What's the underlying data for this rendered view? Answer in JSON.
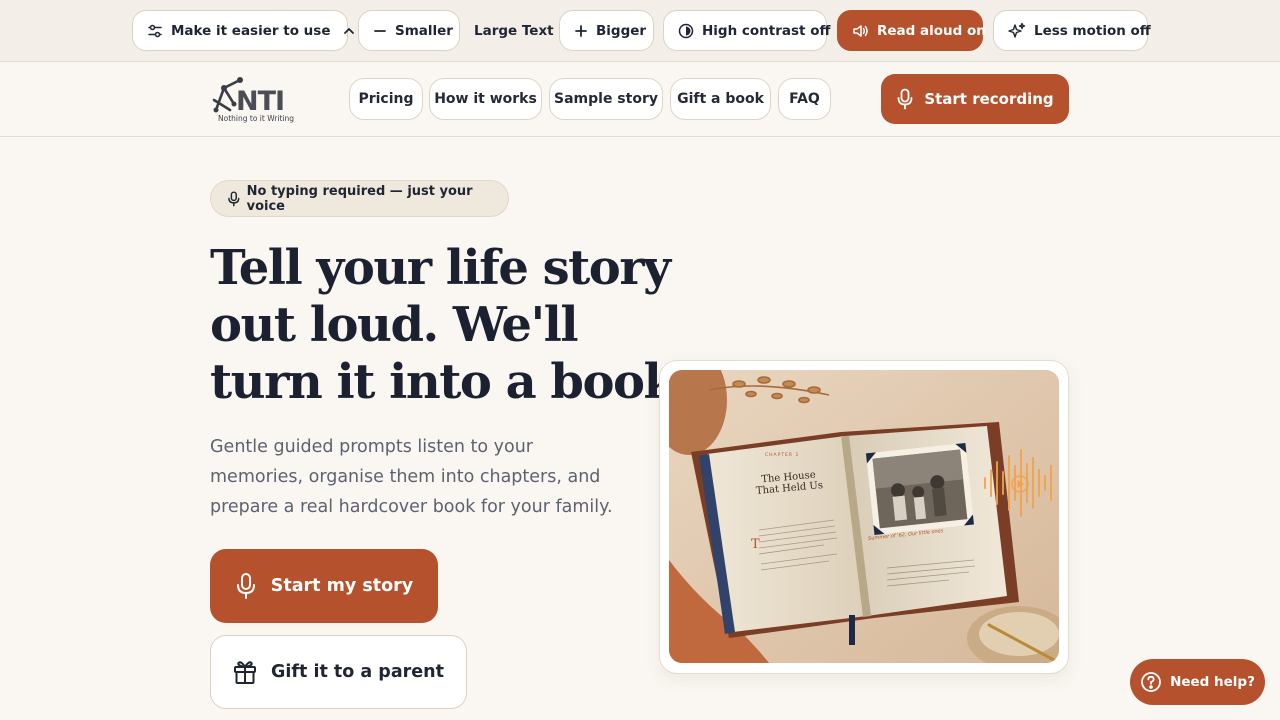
{
  "accessibility_bar": {
    "easier": "Make it easier to use",
    "smaller": "Smaller",
    "text_size": "Large Text",
    "bigger": "Bigger",
    "contrast": "High contrast off",
    "read_aloud": "Read aloud on",
    "motion": "Less motion off"
  },
  "brand": {
    "logo_text": "NTI",
    "tagline": "Nothing to it Writing"
  },
  "nav": {
    "links": [
      "Pricing",
      "How it works",
      "Sample story",
      "Gift a book",
      "FAQ"
    ],
    "record_label": "Start recording"
  },
  "hero": {
    "badge": "No typing required — just your voice",
    "title_lines": [
      "Tell your life story",
      "out loud. We'll",
      "turn it into a book."
    ],
    "subtitle": "Gentle guided prompts listen to your memories, organise them into chapters, and prepare a real hardcover book for your family.",
    "primary_cta": "Start my story",
    "secondary_cta": "Gift it to a parent"
  },
  "book_image": {
    "chapter": "CHAPTER 1",
    "title": "The House That Held Us",
    "caption": "Summer of '62, Our little ones"
  },
  "help": {
    "label": "Need help?"
  },
  "colors": {
    "accent": "#b5512c",
    "background": "#faf7f2",
    "text": "#1b2130"
  },
  "icons": [
    "sliders-icon",
    "chevron-up-icon",
    "minus-icon",
    "plus-icon",
    "contrast-icon",
    "speaker-icon",
    "sparkles-icon",
    "microphone-icon",
    "gift-icon",
    "question-icon",
    "play-icon"
  ]
}
